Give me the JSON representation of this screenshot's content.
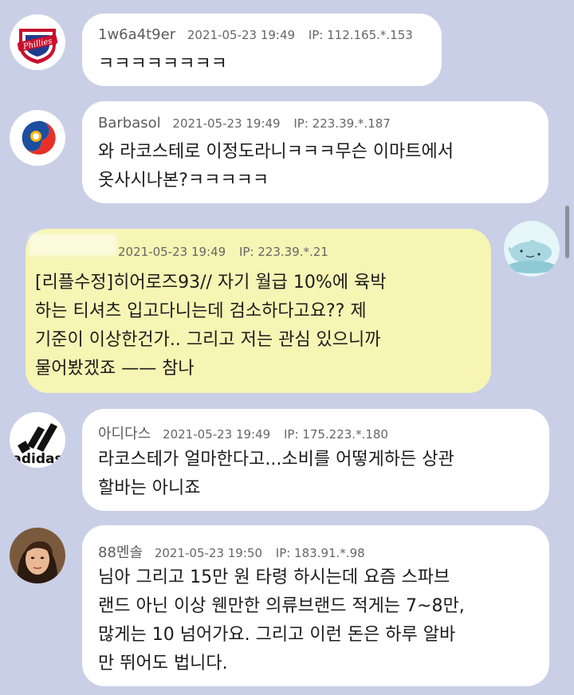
{
  "comments": [
    {
      "nick": "1w6a4t9er",
      "date": "2021-05-23 19:49",
      "ip": "IP: 112.165.*.153",
      "lines": [
        "ㅋㅋㅋㅋㅋㅋㅋㅋ"
      ],
      "avatar": "phillies-logo"
    },
    {
      "nick": "Barbasol",
      "date": "2021-05-23 19:49",
      "ip": "IP: 223.39.*.187",
      "lines": [
        "와 라코스테로 이정도라니ㅋㅋㅋ무슨 이마트에서",
        "옷사시나본?ㅋㅋㅋㅋㅋ"
      ],
      "avatar": "korea-taegeuk-logo"
    },
    {
      "nick": "",
      "date": "2021-05-23 19:49",
      "ip": "IP: 223.39.*.21",
      "lines": [
        "[리플수정]히어로즈93// 자기 월급 10%에 육박",
        "하는 티셔츠 입고다니는데 검소하다고요?? 제",
        "기준이 이상한건가.. 그리고 저는 관심 있으니까",
        "물어봤겠죠 —— 참나"
      ],
      "avatar": "dolphin-avatar"
    },
    {
      "nick": "아디다스",
      "date": "2021-05-23 19:49",
      "ip": "IP: 175.223.*.180",
      "lines": [
        "라코스테가 얼마한다고...소비를 어떻게하든 상관",
        "할바는 아니죠"
      ],
      "avatar": "adidas-logo",
      "avatar_text": "adidas"
    },
    {
      "nick": "88멘솔",
      "date": "2021-05-23 19:50",
      "ip": "IP: 183.91.*.98",
      "lines": [
        "님아 그리고 15만 원 타령 하시는데 요즘 스파브",
        "랜드 아닌 이상 웬만한 의류브랜드 적게는 7~8만,",
        "많게는 10 넘어가요. 그리고 이런 돈은 하루 알바",
        "만 뛰어도 법니다."
      ],
      "avatar": "portrait-photo"
    }
  ],
  "colors": {
    "background": "#c9cfe6",
    "bubble_other": "#ffffff",
    "bubble_mine": "#f6f5b4"
  }
}
